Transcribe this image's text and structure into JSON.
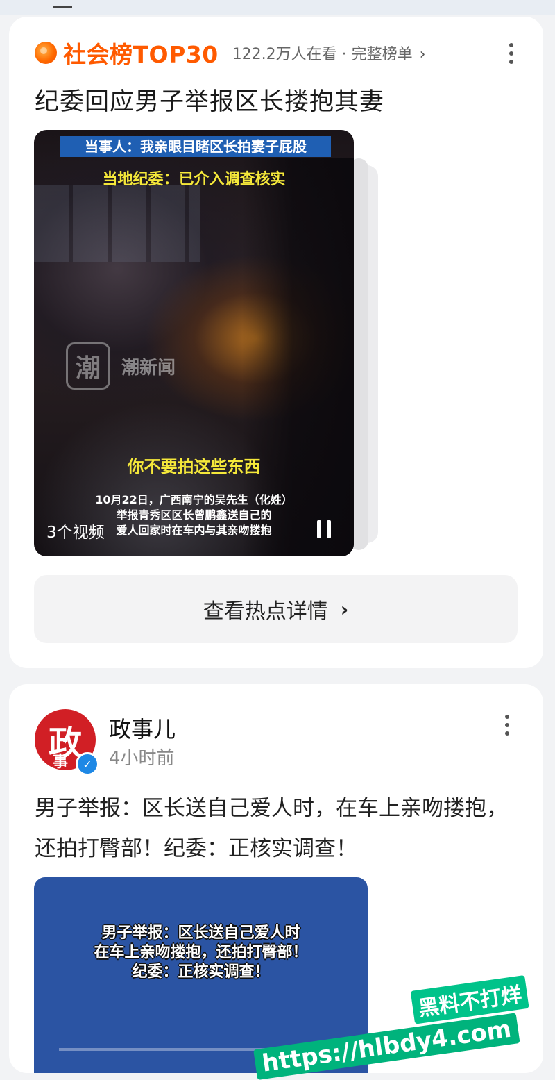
{
  "hotlist": {
    "title": "社会榜TOP30",
    "meta": "122.2万人在看 · 完整榜单",
    "chevron": "›",
    "headline": "纪委回应男子举报区长搂抱其妻",
    "video": {
      "band1": "当事人：我亲眼目睹区长拍妻子屁股",
      "band2": "当地纪委：已介入调查核实",
      "watermark_logo": "潮",
      "watermark_text": "潮新闻",
      "quote": "你不要拍这些东西",
      "caption_lines": [
        "10月22日，广西南宁的吴先生（化姓）",
        "举报青秀区区长曾鹏鑫送自己的",
        "爱人回家时在车内与其亲吻搂抱"
      ],
      "count_label": "3个视频"
    },
    "detail_button": "查看热点详情",
    "detail_chevron": "›"
  },
  "post": {
    "avatar_main": "政",
    "avatar_sub": "事",
    "verified_mark": "✓",
    "author": "政事儿",
    "time": "4小时前",
    "text": "男子举报：区长送自己爱人时，在车上亲吻搂抱，还拍打臀部！纪委：正核实调查！",
    "image_lines": [
      "男子举报：区长送自己爱人时",
      "在车上亲吻搂抱，还拍打臀部！",
      "纪委：正核实调查！"
    ]
  },
  "overlay_watermark": {
    "line1": "黑料不打烊",
    "line2": "https://hlbdy4.com"
  },
  "colors": {
    "accent_orange": "#ff5a00",
    "verified_blue": "#1e88e5",
    "avatar_red": "#d11f25",
    "video_caption_yellow": "#f5e83a"
  },
  "icons": [
    "fire-dot-icon",
    "more-vertical-icon",
    "pause-icon",
    "chevron-right-icon",
    "verified-badge-icon"
  ]
}
